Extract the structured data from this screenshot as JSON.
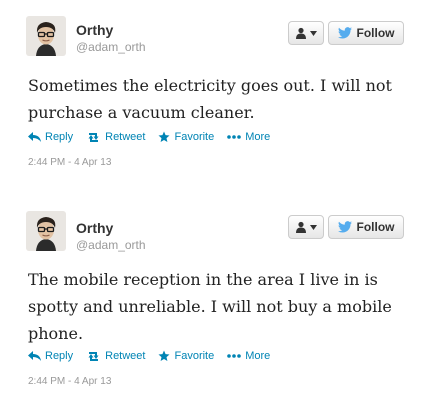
{
  "tweets": [
    {
      "user": {
        "name": "Orthy",
        "handle": "@adam_orth"
      },
      "follow_label": "Follow",
      "text": "Sometimes the electricity goes out. I will not purchase a vacuum cleaner.",
      "actions": {
        "reply": "Reply",
        "retweet": "Retweet",
        "favorite": "Favorite",
        "more": "More"
      },
      "timestamp": "2:44 PM - 4 Apr 13"
    },
    {
      "user": {
        "name": "Orthy",
        "handle": "@adam_orth"
      },
      "follow_label": "Follow",
      "text": "The mobile reception in the area I live in is spotty and unreliable. I will not buy a mobile phone.",
      "actions": {
        "reply": "Reply",
        "retweet": "Retweet",
        "favorite": "Favorite",
        "more": "More"
      },
      "timestamp": "2:44 PM - 4 Apr 13"
    }
  ],
  "colors": {
    "link": "#0084b4",
    "twitter_bird": "#55acee",
    "name": "#333333",
    "muted": "#999999",
    "text": "#222222",
    "favorite_star": "#0084b4"
  }
}
